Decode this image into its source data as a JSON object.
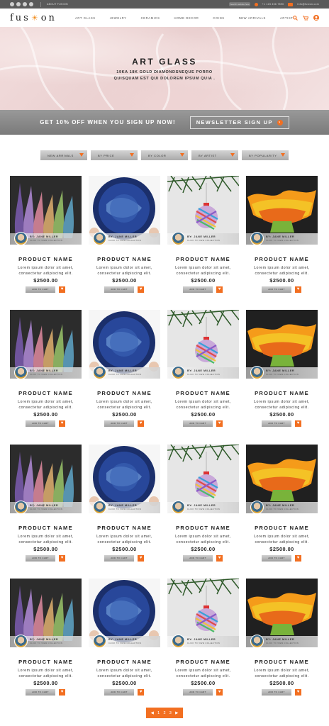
{
  "topbar": {
    "about": "ABOUT FUSION",
    "search_placeholder": "Search website here",
    "phone": "+1 123 456 7890",
    "email": "info@fusion.com"
  },
  "header": {
    "logo_left": "fus",
    "logo_sun": "☀",
    "logo_right": "on",
    "menu": [
      "ART GLASS",
      "JEWELRY",
      "CERAMICS",
      "HOME DECOR",
      "COINS",
      "NEW ARRIVALS",
      "ARTIST"
    ]
  },
  "hero": {
    "title": "ART GLASS",
    "subtitle_line1": "19KA 18K GOLD DIAMONDSNEQUE PORRO",
    "subtitle_line2": "QUISQUAM EST QUI DOLOREM IPSUM QUIA ."
  },
  "banner": {
    "offer": "GET 10% OFF WHEN YOU SIGN UP NOW!",
    "newsletter": "NEWSLETTER SIGN UP"
  },
  "filters": [
    "NEW ARRIVALS",
    "BY PRICE",
    "BY COLOR",
    "BY ARTIST",
    "BY POPULARITY"
  ],
  "product": {
    "artist_by": "BY: JANE MILLER",
    "artist_link": "CLICK TO VIEW COLLECTION",
    "name": "PRODUCT NAME",
    "desc_line1": "Lorem ipsum dolor sit amet,",
    "desc_line2": "consectetur adipiscing elit.",
    "price": "$2500.00",
    "add_to_cart": "ADD TO CART"
  },
  "product_images": [
    "glass-vases",
    "blue-plate",
    "striped-ornament",
    "orange-bowl"
  ],
  "rows": 4,
  "pagination": {
    "prev": "◀",
    "pages": [
      "1",
      "2",
      "3"
    ],
    "next": "▶"
  },
  "colors": {
    "accent": "#f26f21",
    "topbar": "#5a5a5a",
    "banner": "#8a8a8a",
    "hero": "#f0d9d9"
  }
}
